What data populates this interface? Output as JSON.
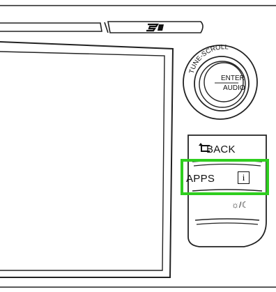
{
  "disc_logo": "SD",
  "knob": {
    "ring_label": "TUNE-SCROLL",
    "center_line1": "ENTER",
    "center_line2": "AUDIO"
  },
  "buttons": {
    "back_label": "BACK",
    "apps_label": "APPS",
    "info_glyph": "i",
    "brightness_glyph": "☼/☾"
  },
  "highlight_color": "#2fce1f"
}
